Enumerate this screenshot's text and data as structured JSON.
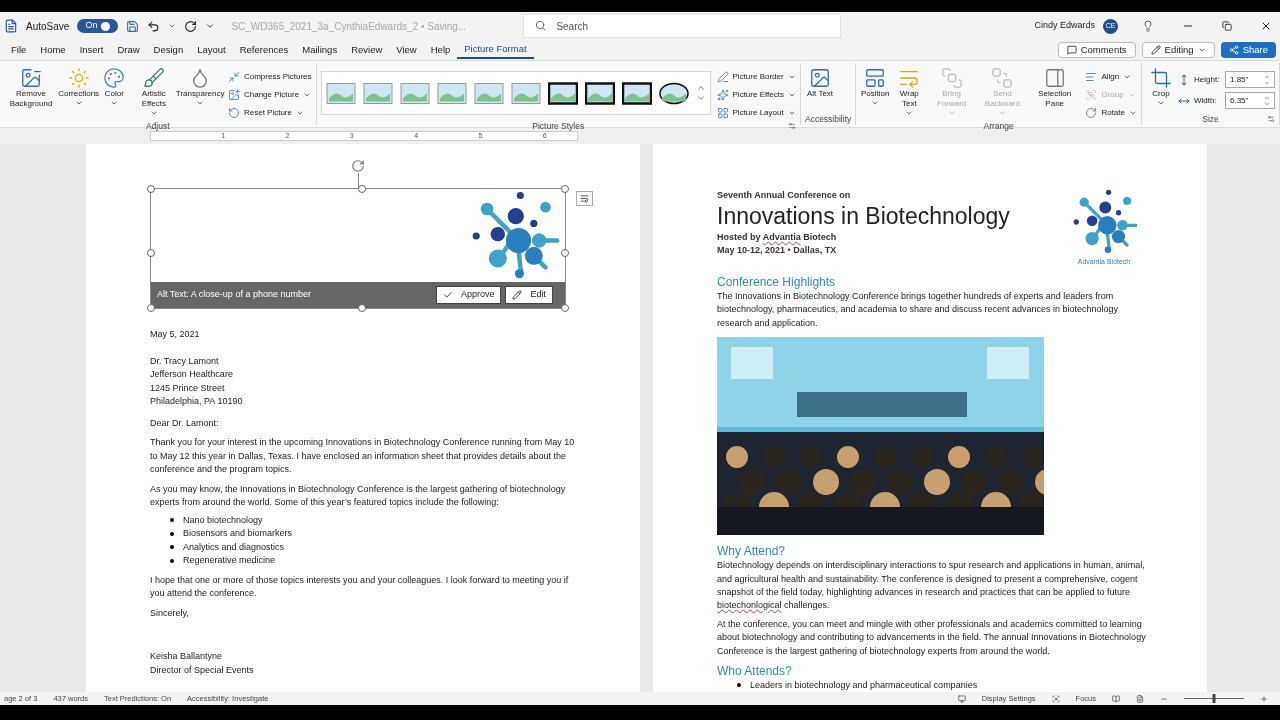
{
  "title_bar": {
    "autosave_label": "AutoSave",
    "autosave": {
      "label": "On",
      "on": true
    },
    "document_title": "SC_WD365_2021_3a_CynthiaEdwards_2 • Saving...",
    "search": {
      "placeholder": "Search"
    },
    "user_name": "Cindy Edwards",
    "avatar_initials": "CE"
  },
  "menu_tabs": [
    {
      "label": "File",
      "selected": false
    },
    {
      "label": "Home",
      "selected": false
    },
    {
      "label": "Insert",
      "selected": false
    },
    {
      "label": "Draw",
      "selected": false
    },
    {
      "label": "Design",
      "selected": false
    },
    {
      "label": "Layout",
      "selected": false
    },
    {
      "label": "References",
      "selected": false
    },
    {
      "label": "Mailings",
      "selected": false
    },
    {
      "label": "Review",
      "selected": false
    },
    {
      "label": "View",
      "selected": false
    },
    {
      "label": "Help",
      "selected": false
    },
    {
      "label": "Picture Format",
      "selected": true
    }
  ],
  "actions": [
    {
      "label": "Comments",
      "kind": "comments"
    },
    {
      "label": "Editing",
      "kind": "editing"
    },
    {
      "label": "Share",
      "kind": "share"
    }
  ],
  "ribbon": {
    "groups": [
      {
        "label": "Adjust",
        "kind": "buttons",
        "large": [
          {
            "label": "Remove Background",
            "dropdown": false,
            "disabled": false
          },
          {
            "label": "Corrections",
            "dropdown": true,
            "disabled": false
          },
          {
            "label": "Color",
            "dropdown": true,
            "disabled": false
          },
          {
            "label": "Artistic Effects",
            "dropdown": true,
            "disabled": false
          },
          {
            "label": "Transparency",
            "dropdown": true,
            "disabled": false
          }
        ],
        "small": [
          {
            "label": "Compress Pictures",
            "dropdown": false,
            "disabled": false
          },
          {
            "label": "Change Picture",
            "dropdown": true,
            "disabled": false
          },
          {
            "label": "Reset Picture",
            "dropdown": true,
            "disabled": false
          }
        ]
      },
      {
        "label": "Picture Styles",
        "kind": "gallery",
        "small": [
          {
            "label": "Picture Border",
            "dropdown": true,
            "disabled": false
          },
          {
            "label": "Picture Effects",
            "dropdown": true,
            "disabled": false
          },
          {
            "label": "Picture Layout",
            "dropdown": true,
            "disabled": false
          }
        ]
      },
      {
        "label": "Accessibility",
        "kind": "buttons",
        "large": [
          {
            "label": "Alt Text",
            "dropdown": false,
            "disabled": false
          }
        ]
      },
      {
        "label": "Arrange",
        "kind": "buttons",
        "large": [
          {
            "label": "Position",
            "dropdown": true,
            "disabled": false
          },
          {
            "label": "Wrap Text",
            "dropdown": true,
            "disabled": false
          },
          {
            "label": "Bring Forward",
            "dropdown": true,
            "disabled": true
          },
          {
            "label": "Send Backward",
            "dropdown": true,
            "disabled": true
          },
          {
            "label": "Selection Pane",
            "dropdown": false,
            "disabled": false
          }
        ],
        "small": [
          {
            "label": "Align",
            "dropdown": true,
            "disabled": false
          },
          {
            "label": "Group",
            "dropdown": true,
            "disabled": true
          },
          {
            "label": "Rotate",
            "dropdown": true,
            "disabled": false
          }
        ]
      },
      {
        "label": "Size",
        "kind": "size",
        "large": [
          {
            "label": "Crop",
            "dropdown": true,
            "disabled": false
          }
        ],
        "fields": [
          {
            "label": "Height:",
            "value": "1.85\""
          },
          {
            "label": "Width:",
            "value": "6.35\""
          }
        ]
      }
    ]
  },
  "ruler": {
    "numbers": [
      "1",
      "2",
      "3",
      "4",
      "5",
      "6"
    ]
  },
  "left_page": {
    "alt_text_bar": {
      "text": "Alt Text: A close-up of a phone number",
      "approve": "Approve",
      "edit": "Edit"
    },
    "date": "May 5, 2021",
    "address": [
      "Dr. Tracy Lamont",
      "Jefferson Healthcare",
      "1245 Prince Street",
      "Philadelphia, PA 10190"
    ],
    "salutation": "Dear Dr. Lamont:",
    "paragraphs": [
      "Thank you for your interest in the upcoming Innovations in Biotechnology Conference running from May 10 to May 12 this year in Dallas, Texas. I have enclosed an information sheet that provides details about the conference and the program topics.",
      "As you may know, the Innovations in Biotechnology Conference is the largest gathering of biotechnology experts from around the world. Some of this year’s featured topics include the following:"
    ],
    "bullets": [
      "Nano biotechnology",
      "Biosensors and biomarkers",
      "Analytics and diagnostics",
      "Regenerative medicine"
    ],
    "closing_paragraph": "I hope that one or more of those topics interests you and your colleagues. I look forward to meeting you if you attend the conference.",
    "closing": "Sincerely,",
    "signature": [
      "Keisha Ballantyne",
      "Director of Special Events"
    ]
  },
  "right_page": {
    "kicker": "Seventh Annual Conference on",
    "title": "Innovations in Biotechnology",
    "hosted": [
      {
        "text": "Hosted by ",
        "misspelled": false
      },
      {
        "text": "Advantia",
        "misspelled": true
      },
      {
        "text": " Biotech",
        "misspelled": false
      }
    ],
    "dates": "May 10-12, 2021 • Dallas, TX",
    "logo_caption": "Advantia Biotech",
    "highlights": {
      "heading": "Conference Highlights",
      "paragraph": [
        {
          "text": "The Innovations in Biotechnology Conference brings together hundreds of experts and leaders from biotechnology, pharmaceutics, and academia to share and discuss recent advances in biotechnology research and application.",
          "misspelled": false
        }
      ]
    },
    "why": {
      "heading": "Why Attend?",
      "paragraphs": [
        [
          {
            "text": "Biotechnology depends on interdisciplinary interactions to spur research and applications in human, animal, and agricultural health and sustainability. The conference is designed to present a comprehensive, cogent snapshot of the field today, highlighting advances in research and practices that can be applied to future ",
            "misspelled": false
          },
          {
            "text": "biotechonlogical",
            "misspelled": true
          },
          {
            "text": " challenges.",
            "misspelled": false
          }
        ],
        [
          {
            "text": "At the conference, you can meet and mingle with other professionals and academics committed to learning about biotechnology and contributing to advancements in the field. The annual Innovations in Biotechnology Conference is the largest gathering of biotechnology experts from around the world.",
            "misspelled": false
          }
        ]
      ]
    },
    "who": {
      "heading": "Who Attends?",
      "bullets": [
        "Leaders in biotechnology and pharmaceutical companies"
      ]
    }
  },
  "status_bar": {
    "left": [
      "age 2 of 3",
      "437 words",
      "Text Predictions: On",
      "Accessibility: Investigate"
    ],
    "right": [
      "Display Settings",
      "Focus"
    ],
    "zoom": {
      "level": 0.5
    }
  }
}
